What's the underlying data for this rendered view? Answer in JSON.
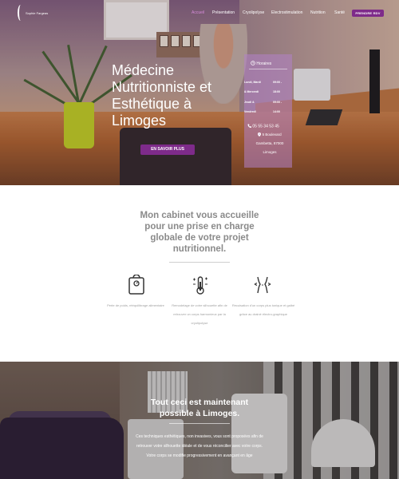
{
  "header": {
    "logo_text": "Sophie Fargeas",
    "nav": [
      {
        "label": "Accueil",
        "active": true
      },
      {
        "label": "Présentation",
        "active": false
      },
      {
        "label": "Cryolipolyse",
        "active": false
      },
      {
        "label": "Electrostimulation",
        "active": false
      },
      {
        "label": "Nutrition",
        "active": false
      },
      {
        "label": "Santé",
        "active": false
      }
    ],
    "cta_label": "PRENDRE RDV"
  },
  "hero": {
    "title": "Médecine Nutritionniste et Esthétique à Limoges",
    "button_label": "EN SAVOIR PLUS"
  },
  "hours_card": {
    "heading": "Horaires",
    "rows": [
      {
        "days": "Lundi, Mardi",
        "start": "09:00 -"
      },
      {
        "days": "& Mercredi",
        "start": "",
        "end": "18:00"
      },
      {
        "days": "Jeudi &",
        "start": "09:00 -"
      },
      {
        "days": "Vendredi",
        "start": "",
        "end": "14:00"
      }
    ],
    "phone": "05 55 34 53 45",
    "address_lines": [
      "5 Boulevard",
      "Gambetta, 87000",
      "Limoges"
    ]
  },
  "intro": {
    "title": "Mon cabinet vous accueille pour une prise en charge globale de votre projet nutritionnel."
  },
  "features": [
    {
      "icon": "scale-icon",
      "text": "Perte de poids, rééquilibrage alimentaire"
    },
    {
      "icon": "thermometer-icon",
      "text": "Remodelage de votre silhouette afin de retrouver un corps harmonieux par la cryolipolyse"
    },
    {
      "icon": "body-silhouette-icon",
      "text": "Recuisation d'un corps plus tonique et galbé grâce au drainé électro-graphique"
    }
  ],
  "bottom": {
    "title": "Tout ceci est maintenant possible à Limoges.",
    "text": "Ces techniques esthétiques, non invasives, vous sont proposées afin de retrouver votre silhouette idéale et de vous réconcilier avec votre corps. Votre corps se modifie progressivement en avançant en âge"
  },
  "colors": {
    "accent": "#7e2b8a",
    "nav_active": "#d58ad8",
    "card_overlay": "#b282c8",
    "intro_text": "#8a8a8a"
  }
}
